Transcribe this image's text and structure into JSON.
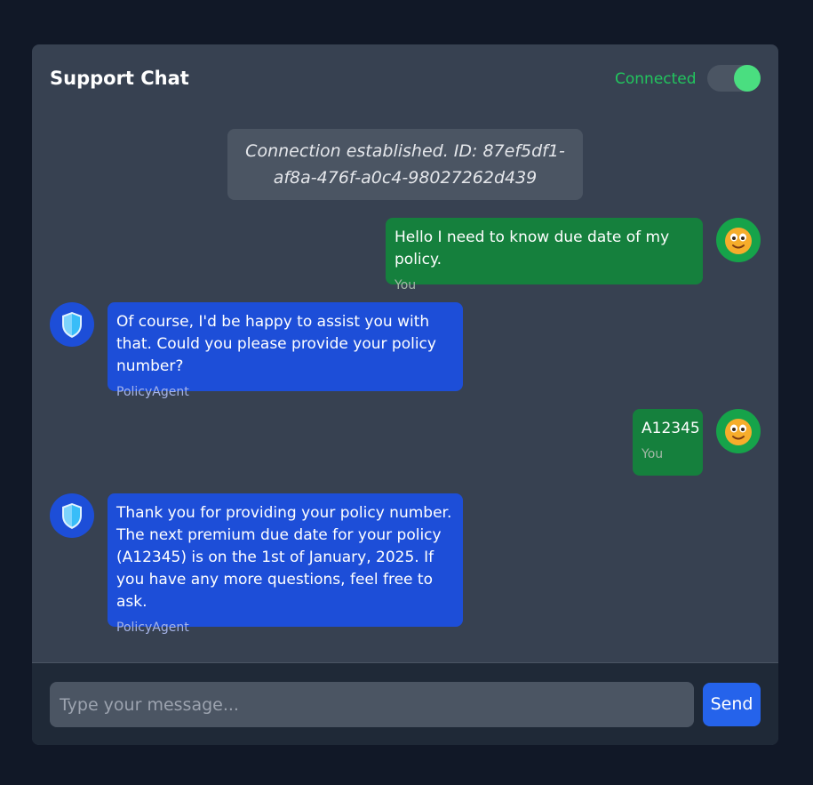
{
  "header": {
    "title": "Support Chat",
    "status": "Connected",
    "toggle_on": true
  },
  "system_message": "Connection established. ID: 87ef5df1-af8a-476f-a0c4-98027262d439",
  "messages": [
    {
      "role": "user",
      "text": "Hello I need to know due date of my policy.",
      "sender": "You",
      "avatar": "smiley-face-icon"
    },
    {
      "role": "agent",
      "text": "Of course, I'd be happy to assist you with that. Could you please provide your policy number?",
      "sender": "PolicyAgent",
      "avatar": "shield-icon"
    },
    {
      "role": "user",
      "text": "A12345",
      "sender": "You",
      "avatar": "smiley-face-icon"
    },
    {
      "role": "agent",
      "text": "Thank you for providing your policy number. The next premium due date for your policy (A12345) is on the 1st of January, 2025. If you have any more questions, feel free to ask.",
      "sender": "PolicyAgent",
      "avatar": "shield-icon"
    }
  ],
  "composer": {
    "placeholder": "Type your message...",
    "value": "",
    "send_label": "Send"
  },
  "colors": {
    "user_bubble": "#15803d",
    "agent_bubble": "#1d4ed8",
    "status": "#22c55e",
    "send": "#2563eb"
  }
}
